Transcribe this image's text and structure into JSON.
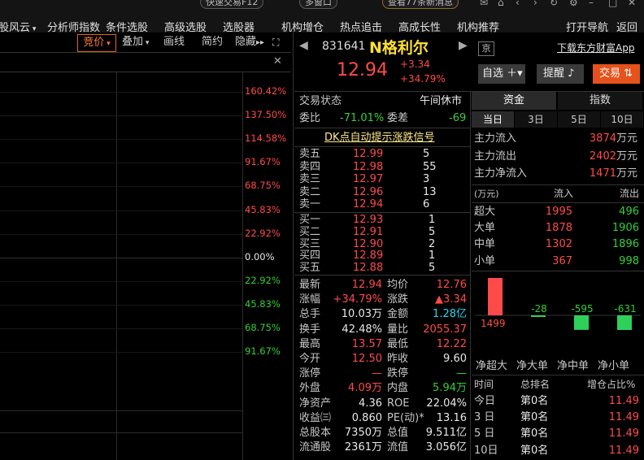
{
  "topbar": {
    "btn1": "快速交易F12",
    "btn2": "多窗口",
    "btn3": "查看77条新消息",
    "nav": [
      "股风云",
      "分析师指数",
      "条件选股",
      "高级选股",
      "选股器",
      "机构增仓",
      "热点追击",
      "高成长性",
      "机构推荐",
      "打开导航",
      "返回"
    ]
  },
  "chart": {
    "toolbar": {
      "auction": "竞价",
      "overlay": "叠加",
      "draw": "画线",
      "simple": "简约",
      "hide": "隐藏"
    },
    "pct_labels": [
      "160.42%",
      "137.50%",
      "114.58%",
      "91.67%",
      "68.75%",
      "45.83%",
      "22.92%",
      "0.00%",
      "22.92%",
      "45.83%",
      "68.75%",
      "91.67%"
    ]
  },
  "stock": {
    "code": "831641",
    "name": "N格利尔",
    "exchange": "京",
    "price": "12.94",
    "change": "+3.34",
    "change_pct": "+34.79%",
    "download": "下载东方财富App",
    "watch": "自选",
    "alert": "提醒",
    "trade": "交易"
  },
  "status": {
    "label": "交易状态",
    "value": "午间休市",
    "ratio_label": "委比",
    "ratio": "-71.01%",
    "diff_label": "委差",
    "diff": "-69",
    "signal": "DK点自动提示涨跌信号"
  },
  "sell": [
    {
      "label": "卖五",
      "price": "12.99",
      "vol": "5"
    },
    {
      "label": "卖四",
      "price": "12.98",
      "vol": "55"
    },
    {
      "label": "卖三",
      "price": "12.97",
      "vol": "3"
    },
    {
      "label": "卖二",
      "price": "12.96",
      "vol": "13"
    },
    {
      "label": "卖一",
      "price": "12.94",
      "vol": "6"
    }
  ],
  "buy": [
    {
      "label": "买一",
      "price": "12.93",
      "vol": "1"
    },
    {
      "label": "买二",
      "price": "12.91",
      "vol": "5"
    },
    {
      "label": "买三",
      "price": "12.90",
      "vol": "2"
    },
    {
      "label": "买四",
      "price": "12.89",
      "vol": "1"
    },
    {
      "label": "买五",
      "price": "12.88",
      "vol": "5"
    }
  ],
  "stats": [
    {
      "l1": "最新",
      "v1": "12.94",
      "c1": "red",
      "l2": "均价",
      "v2": "12.76",
      "c2": "red"
    },
    {
      "l1": "涨幅",
      "v1": "+34.79%",
      "c1": "red",
      "l2": "涨跌",
      "v2": "▲3.34",
      "c2": "red"
    },
    {
      "l1": "总手",
      "v1": "10.03万",
      "c1": "wht",
      "l2": "金额",
      "v2": "1.28亿",
      "c2": "cyan"
    },
    {
      "l1": "换手",
      "v1": "42.48%",
      "c1": "wht",
      "l2": "量比",
      "v2": "2055.37",
      "c2": "red"
    },
    {
      "l1": "最高",
      "v1": "13.57",
      "c1": "red",
      "l2": "最低",
      "v2": "12.22",
      "c2": "red"
    },
    {
      "l1": "今开",
      "v1": "12.50",
      "c1": "red",
      "l2": "昨收",
      "v2": "9.60",
      "c2": "wht"
    },
    {
      "l1": "涨停",
      "v1": "—",
      "c1": "red",
      "l2": "跌停",
      "v2": "—",
      "c2": "grn"
    },
    {
      "l1": "外盘",
      "v1": "4.09万",
      "c1": "red",
      "l2": "内盘",
      "v2": "5.94万",
      "c2": "grn"
    },
    {
      "l1": "净资产",
      "v1": "4.36",
      "c1": "wht",
      "l2": "ROE",
      "v2": "22.04%",
      "c2": "wht"
    },
    {
      "l1": "收益㈢",
      "v1": "0.860",
      "c1": "wht",
      "l2": "PE(动)*",
      "v2": "13.16",
      "c2": "wht"
    },
    {
      "l1": "总股本",
      "v1": "7350万",
      "c1": "wht",
      "l2": "总值",
      "v2": "9.511亿",
      "c2": "wht"
    },
    {
      "l1": "流通股",
      "v1": "2361万",
      "c1": "wht",
      "l2": "流值",
      "v2": "3.056亿",
      "c2": "wht"
    }
  ],
  "fund": {
    "tab1": "资金",
    "tab2": "指数",
    "periods": [
      "当日",
      "3日",
      "5日",
      "10日"
    ],
    "flows": [
      {
        "label": "主力流入",
        "value": "3874",
        "unit": "万元"
      },
      {
        "label": "主力流出",
        "value": "2402",
        "unit": "万元"
      },
      {
        "label": "主力净流入",
        "value": "1471",
        "unit": "万元"
      }
    ],
    "table_head": {
      "unit": "(万元)",
      "in": "流入",
      "out": "流出"
    },
    "rows": [
      {
        "label": "超大",
        "in": "1995",
        "out": "496"
      },
      {
        "label": "大单",
        "in": "1878",
        "out": "1906"
      },
      {
        "label": "中单",
        "in": "1302",
        "out": "1896"
      },
      {
        "label": "小单",
        "in": "367",
        "out": "998"
      }
    ],
    "bars": {
      "super": 1499,
      "big": -28,
      "mid": -595,
      "small": -631
    },
    "bar_labels": [
      "净超大",
      "净大单",
      "净中单",
      "净小单"
    ],
    "rank_head": {
      "time": "时间",
      "rank": "总排名",
      "share": "增仓占比%"
    },
    "ranks": [
      {
        "t": "今日",
        "r": "第0名",
        "s": "11.49"
      },
      {
        "t": "3 日",
        "r": "第0名",
        "s": "11.49"
      },
      {
        "t": "5 日",
        "r": "第0名",
        "s": "11.49"
      },
      {
        "t": "10日",
        "r": "第0名",
        "s": "11.49"
      }
    ]
  }
}
